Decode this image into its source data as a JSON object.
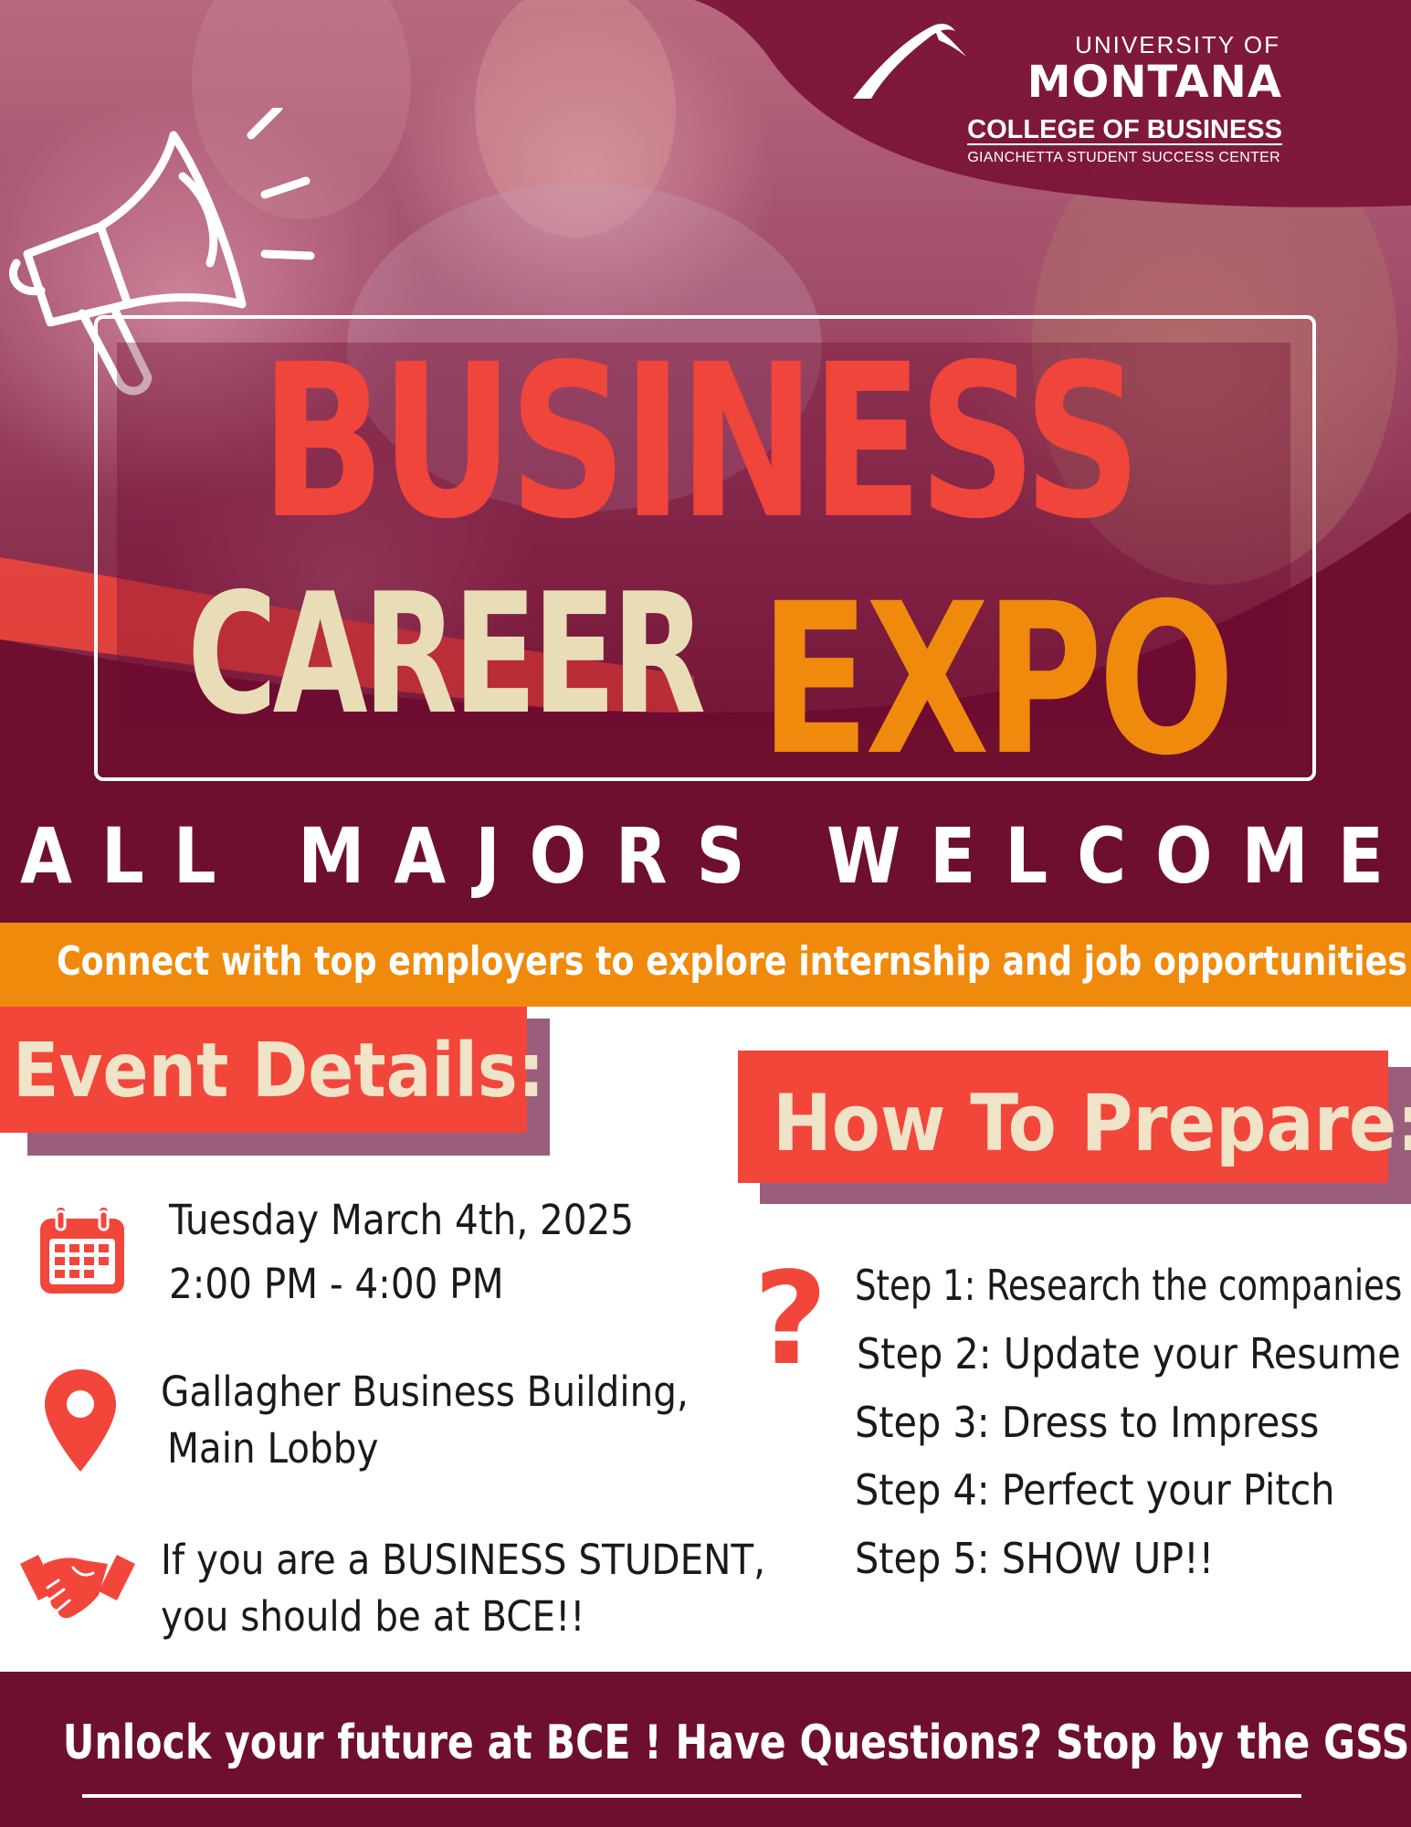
{
  "logo": {
    "line1": "UNIVERSITY OF",
    "line2": "MONTANA",
    "line3": "COLLEGE OF BUSINESS",
    "line4": "GIANCHETTA STUDENT SUCCESS CENTER"
  },
  "headline": {
    "word1": "BUSINESS",
    "word2": "CAREER",
    "word3": "EXPO"
  },
  "tagline": "ALL MAJORS WELCOME",
  "banner": "Connect with top employers to explore internship and job opportunities !!",
  "event_details": {
    "heading": "Event Details:",
    "date": "Tuesday March 4th, 2025",
    "time": "2:00 PM - 4:00 PM",
    "location_line1": "Gallagher Business Building,",
    "location_line2": "Main Lobby",
    "note_line1": "If you are a BUSINESS STUDENT,",
    "note_line2": "you should be at BCE!!"
  },
  "prepare": {
    "heading": "How To Prepare:",
    "question_mark": "?",
    "steps": [
      "Step 1: Research the companies",
      "Step 2: Update your Resume",
      "Step 3: Dress to Impress",
      "Step 4: Perfect your Pitch",
      "Step 5: SHOW UP!!"
    ]
  },
  "footer": "Unlock your future at BCE ! Have Questions? Stop by the GSSC!",
  "icons": [
    "megaphone-icon",
    "mountain-logo-icon",
    "calendar-icon",
    "location-pin-icon",
    "handshake-icon",
    "question-icon"
  ],
  "colors": {
    "maroon": "#6e0f30",
    "red": "#f2463b",
    "orange": "#ef8a0d",
    "cream": "#e9ddb8",
    "purple_shadow": "#9b5d7c"
  }
}
